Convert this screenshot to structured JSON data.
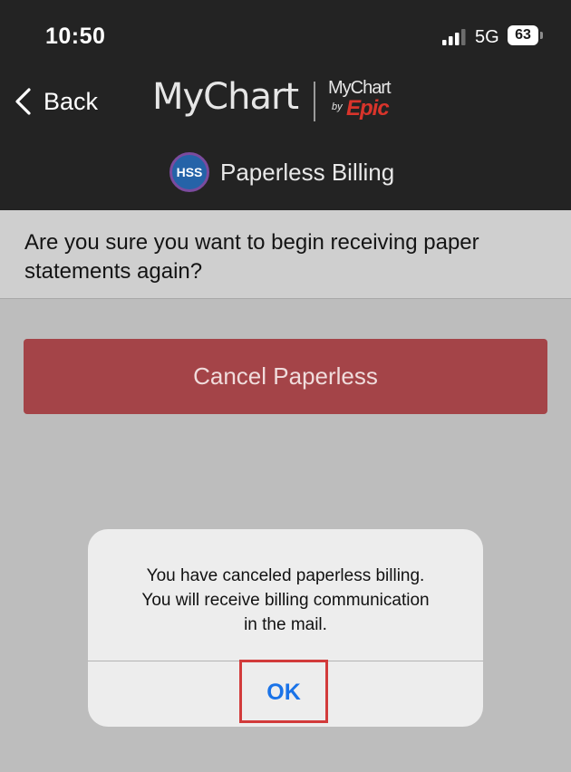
{
  "status_bar": {
    "time": "10:50",
    "network": "5G",
    "battery": "63"
  },
  "header": {
    "back_label": "Back",
    "logo_text": "MyChart",
    "epic_logo_mychart": "MyChart",
    "epic_logo_by": "by",
    "epic_logo_epic": "Epic",
    "org_badge": "HSS",
    "page_title": "Paperless Billing"
  },
  "question": {
    "text": "Are you sure you want to begin receiving paper statements again?"
  },
  "cancel_button": {
    "label": "Cancel Paperless"
  },
  "alert": {
    "message_line1": "You have canceled paperless billing.",
    "message_line2": "You will receive billing communication",
    "message_line3": "in the mail.",
    "ok_label": "OK"
  },
  "colors": {
    "header_bg": "#232323",
    "page_bg": "#bdbdbd",
    "cancel_button_bg": "#a44448",
    "ok_text": "#1a73e8",
    "highlight_border": "#d23b3b"
  },
  "icons": {
    "back": "chevron-left-icon",
    "signal": "signal-bars-icon",
    "battery": "battery-icon"
  }
}
